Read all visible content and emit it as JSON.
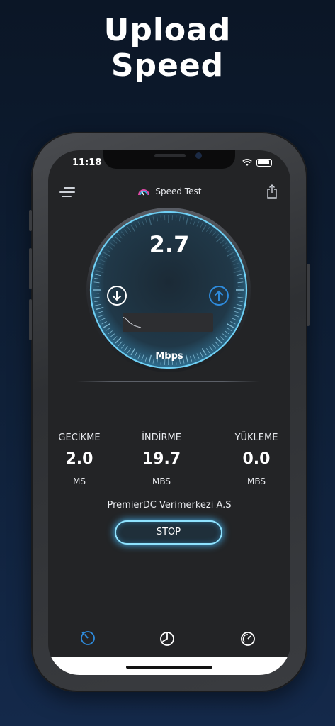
{
  "promo": {
    "line1": "Upload",
    "line2": "Speed"
  },
  "status_bar": {
    "time": "11:18"
  },
  "header": {
    "title": "Speed Test"
  },
  "gauge": {
    "value": "2.7",
    "unit": "Mbps",
    "level": 0.1
  },
  "stats": [
    {
      "label": "GECİKME",
      "value": "2.0",
      "unit": "MS"
    },
    {
      "label": "İNDİRME",
      "value": "19.7",
      "unit": "MBS"
    },
    {
      "label": "YÜKLEME",
      "value": "0.0",
      "unit": "MBS"
    }
  ],
  "server": {
    "name": "PremierDC Verimerkezi A.S"
  },
  "actions": {
    "stop_label": "STOP"
  },
  "tabs": [
    {
      "icon": "speedometer-icon",
      "active": true
    },
    {
      "icon": "history-icon",
      "active": false
    },
    {
      "icon": "gauge-icon",
      "active": false
    }
  ],
  "colors": {
    "accent": "#2e8bdc",
    "glow": "#8fe3ff",
    "screen_bg": "#232426"
  }
}
